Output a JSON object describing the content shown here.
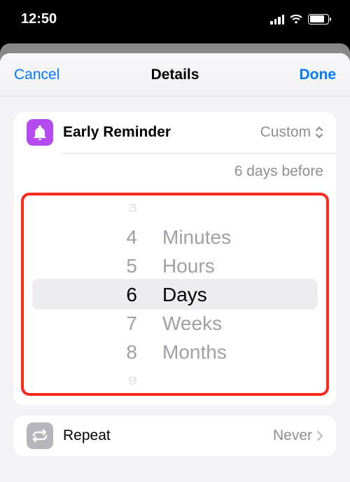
{
  "status": {
    "time": "12:50"
  },
  "nav": {
    "cancel": "Cancel",
    "title": "Details",
    "done": "Done"
  },
  "reminder": {
    "label": "Early Reminder",
    "value": "Custom",
    "summary": "6 days before"
  },
  "picker": {
    "numbers": [
      "3",
      "4",
      "5",
      "6",
      "7",
      "8",
      "9"
    ],
    "units": [
      "Minutes",
      "Hours",
      "Days",
      "Weeks",
      "Months"
    ]
  },
  "repeat": {
    "label": "Repeat",
    "value": "Never"
  }
}
